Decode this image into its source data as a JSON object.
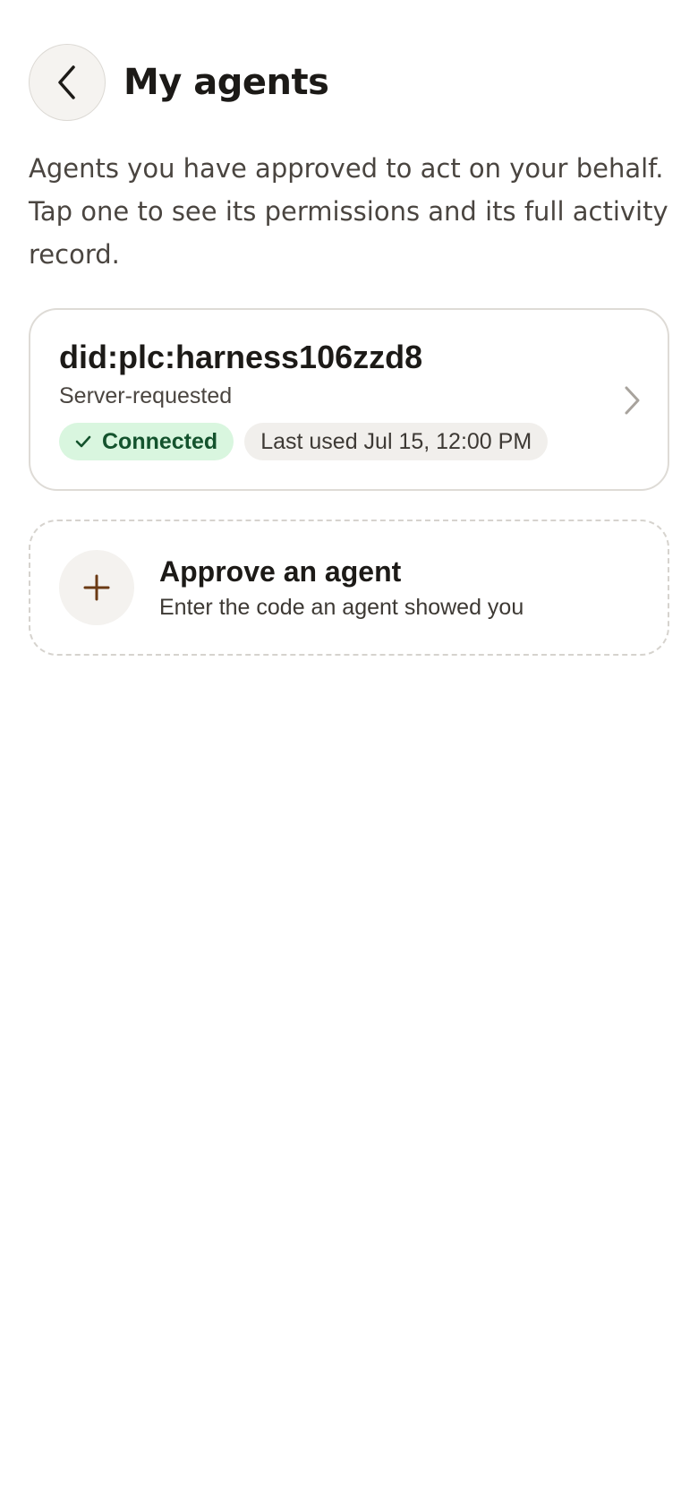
{
  "header": {
    "title": "My agents",
    "back_icon": "chevron-left-icon"
  },
  "intro": {
    "text": "Agents you have approved to act on your behalf. Tap one to see its permissions and its full activity record."
  },
  "agents": [
    {
      "name": "did:plc:harness106zzd8",
      "source": "Server-requested",
      "status": "Connected",
      "status_icon": "check-icon",
      "last_used": "Last used Jul 15, 12:00 PM",
      "chevron_icon": "chevron-right-icon"
    }
  ],
  "approve": {
    "title": "Approve an agent",
    "subtitle": "Enter the code an agent showed you",
    "icon": "plus-icon"
  },
  "colors": {
    "connected_bg": "#d9f6df",
    "connected_text": "#14532d",
    "plus_accent": "#6b3a14"
  }
}
